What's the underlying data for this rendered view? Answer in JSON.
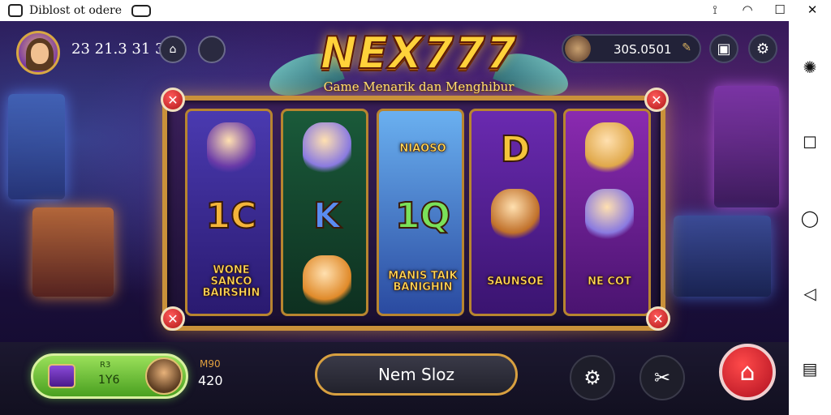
{
  "statusbar": {
    "app_title": "Diblost ot odere",
    "icons": [
      "app-icon",
      "badge-icon",
      "cast-icon",
      "wifi-icon",
      "window-icon",
      "close-icon"
    ]
  },
  "navrail": {
    "icons": [
      "settings-gear-icon",
      "square-icon",
      "chat-icon",
      "back-icon",
      "clipboard-icon"
    ]
  },
  "hud": {
    "player_id": "23 21.3 31 3S",
    "coins": "30S.0501"
  },
  "logo": {
    "title": "NEX777",
    "subtitle": "Game Menarik dan Menghibur"
  },
  "reels": [
    {
      "cells": [
        {
          "kind": "pic",
          "icon": "panther-icon"
        },
        {
          "kind": "letter",
          "text": "1C",
          "color": "#f4b43a"
        },
        {
          "kind": "word",
          "text": "WONE SANCO BAIRSHIN"
        }
      ]
    },
    {
      "cells": [
        {
          "kind": "pic",
          "icon": "wolf-icon"
        },
        {
          "kind": "letter",
          "text": "K",
          "color": "#5a8cf0"
        },
        {
          "kind": "pic",
          "icon": "pouch-icon"
        }
      ]
    },
    {
      "cells": [
        {
          "kind": "word",
          "text": "NIAOSO"
        },
        {
          "kind": "letter",
          "text": "1Q",
          "color": "#7ae05a"
        },
        {
          "kind": "word",
          "text": "MANIS TAIK BANIGHIN"
        }
      ]
    },
    {
      "cells": [
        {
          "kind": "letter",
          "text": "D",
          "color": "#f4c43a"
        },
        {
          "kind": "pic",
          "icon": "horn-icon"
        },
        {
          "kind": "word",
          "text": "SAUNSOE"
        }
      ]
    },
    {
      "cells": [
        {
          "kind": "pic",
          "icon": "queen-icon"
        },
        {
          "kind": "pic",
          "icon": "wolf-icon"
        },
        {
          "kind": "word",
          "text": "NE COT"
        }
      ]
    }
  ],
  "bottom": {
    "balance_label": "R3",
    "balance_value": "1Y6",
    "bet_label": "M90",
    "bet_value": "420",
    "spin_label": "Nem Sloz"
  },
  "colors": {
    "accent_gold": "#c9913a",
    "close_red": "#d02020",
    "balance_green": "#6ac02a"
  }
}
